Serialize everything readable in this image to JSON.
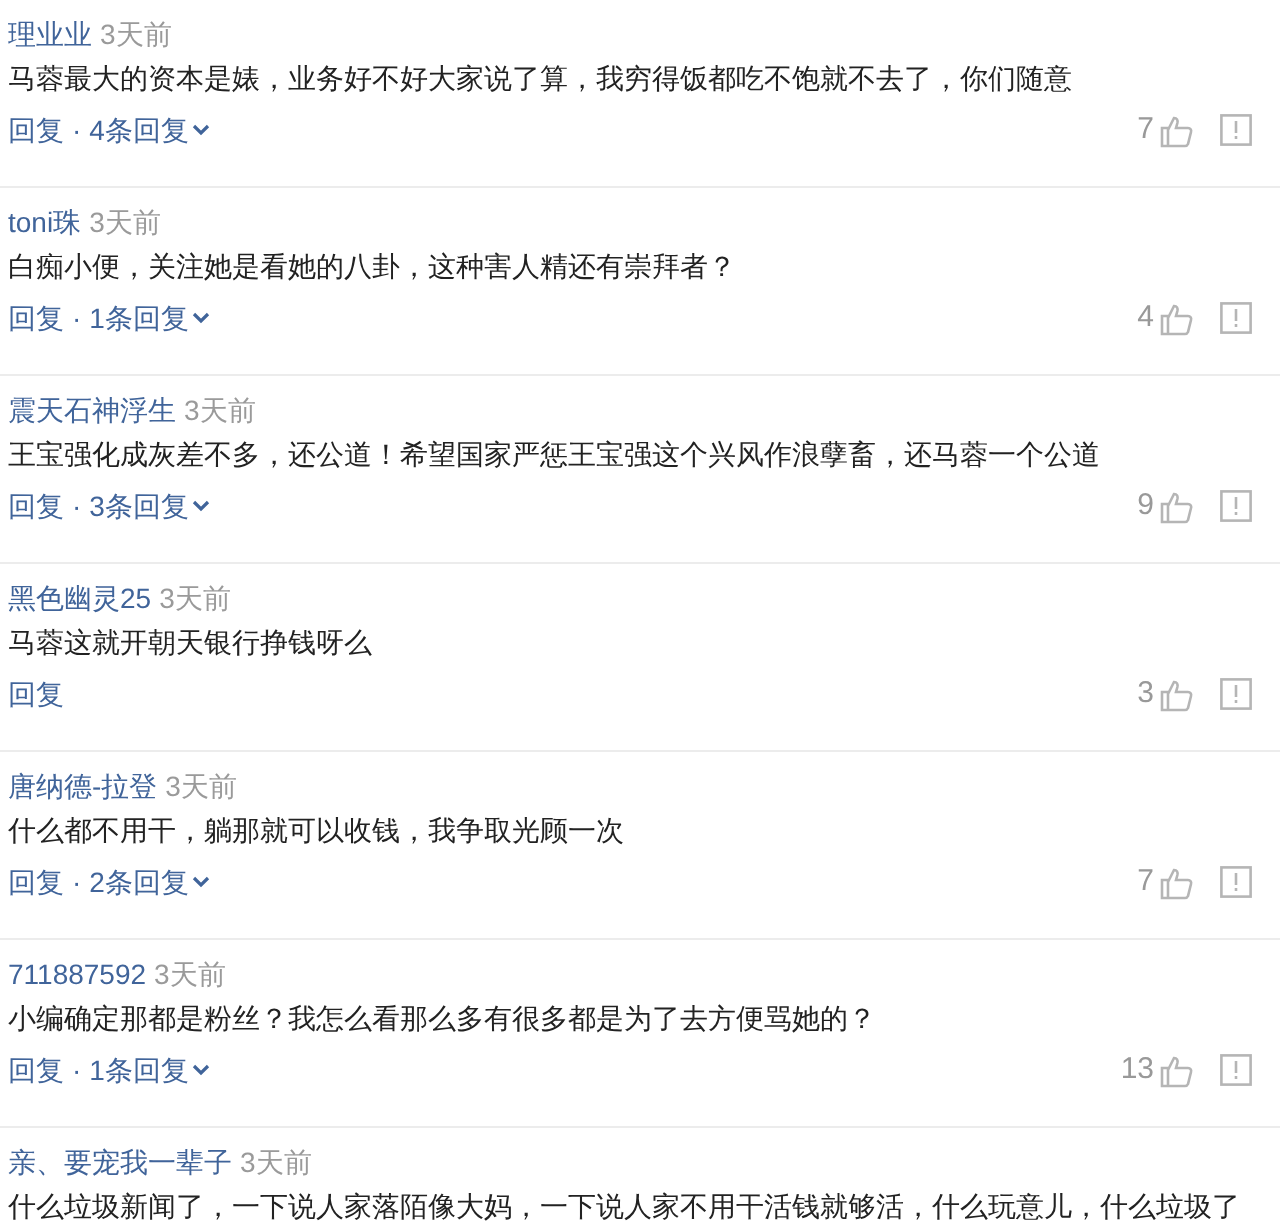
{
  "comments": [
    {
      "author": "理业业",
      "time": "3天前",
      "text": "马蓉最大的资本是婊，业务好不好大家说了算，我穷得饭都吃不饱就不去了，你们随意",
      "reply_label": "回复",
      "separator": "·",
      "reply_count": "4条回复",
      "likes": "7"
    },
    {
      "author": "toni珠",
      "time": "3天前",
      "text": "白痴小便，关注她是看她的八卦，这种害人精还有崇拜者？",
      "reply_label": "回复",
      "separator": "·",
      "reply_count": "1条回复",
      "likes": "4"
    },
    {
      "author": "震天石神浮生",
      "time": "3天前",
      "text": "王宝强化成灰差不多，还公道！希望国家严惩王宝强这个兴风作浪孽畜，还马蓉一个公道",
      "reply_label": "回复",
      "separator": "·",
      "reply_count": "3条回复",
      "likes": "9"
    },
    {
      "author": "黑色幽灵25",
      "time": "3天前",
      "text": "马蓉这就开朝天银行挣钱呀么",
      "reply_label": "回复",
      "likes": "3"
    },
    {
      "author": "唐纳德-拉登",
      "time": "3天前",
      "text": "什么都不用干，躺那就可以收钱，我争取光顾一次",
      "reply_label": "回复",
      "separator": "·",
      "reply_count": "2条回复",
      "likes": "7"
    },
    {
      "author": "711887592",
      "time": "3天前",
      "text": "小编确定那都是粉丝？我怎么看那么多有很多都是为了去方便骂她的？",
      "reply_label": "回复",
      "separator": "·",
      "reply_count": "1条回复",
      "likes": "13"
    },
    {
      "author": "亲、要宠我一辈子",
      "time": "3天前",
      "text": "什么垃圾新闻了，一下说人家落陌像大妈，一下说人家不用干活钱就够活，什么玩意儿，什么垃圾了"
    }
  ]
}
